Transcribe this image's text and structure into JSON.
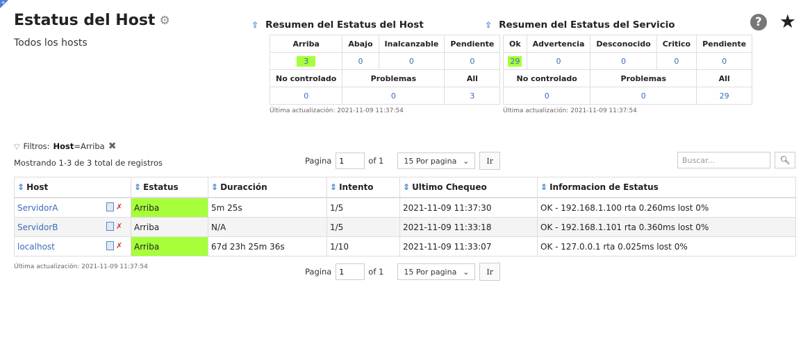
{
  "page": {
    "title": "Estatus del Host",
    "subtitle": "Todos los hosts"
  },
  "host_summary": {
    "title": "Resumen del Estatus del Host",
    "row1_headers": [
      "Arriba",
      "Abajo",
      "Inalcanzable",
      "Pendiente"
    ],
    "row1_values": [
      "3",
      "0",
      "0",
      "0"
    ],
    "row2_headers": [
      "No controlado",
      "Problemas",
      "All"
    ],
    "row2_values": [
      "0",
      "0",
      "3"
    ],
    "updated": "Última actualización: 2021-11-09 11:37:54"
  },
  "service_summary": {
    "title": "Resumen del Estatus del Servicio",
    "row1_headers": [
      "Ok",
      "Advertencia",
      "Desconocido",
      "Critico",
      "Pendiente"
    ],
    "row1_values": [
      "29",
      "0",
      "0",
      "0",
      "0"
    ],
    "row2_headers": [
      "No controlado",
      "Problemas",
      "All"
    ],
    "row2_values": [
      "0",
      "0",
      "29"
    ],
    "updated": "Última actualización: 2021-11-09 11:37:54"
  },
  "filters": {
    "label": "Filtros:",
    "key": "Host",
    "value": "=Arriba",
    "showing": "Mostrando 1-3 de 3 total de registros"
  },
  "pager": {
    "label": "Pagina",
    "page": "1",
    "of": "of 1",
    "per_page": "15 Por pagina",
    "go": "Ir"
  },
  "search": {
    "placeholder": "Buscar..."
  },
  "table": {
    "headers": [
      "Host",
      "Estatus",
      "Duracción",
      "Intento",
      "Ultimo Chequeo",
      "Informacion de Estatus"
    ],
    "rows": [
      {
        "host": "ServidorA",
        "status": "Arriba",
        "duration": "5m 25s",
        "attempt": "1/5",
        "last_check": "2021-11-09 11:37:30",
        "info": "OK - 192.168.1.100 rta 0.260ms lost 0%"
      },
      {
        "host": "ServidorB",
        "status": "Arriba",
        "duration": "N/A",
        "attempt": "1/5",
        "last_check": "2021-11-09 11:33:18",
        "info": "OK - 192.168.1.101 rta 0.360ms lost 0%"
      },
      {
        "host": "localhost",
        "status": "Arriba",
        "duration": "67d 23h 25m 36s",
        "attempt": "1/10",
        "last_check": "2021-11-09 11:33:07",
        "info": "OK - 127.0.0.1 rta 0.025ms lost 0%"
      }
    ],
    "updated": "Última actualización: 2021-11-09 11:37:54"
  },
  "colors": {
    "status_up": "#a6ff3a",
    "link": "#3a6bb8",
    "accent": "#3b82d6"
  },
  "icons": [
    "gear-icon",
    "help-icon",
    "star-icon",
    "pin-icon",
    "funnel-icon",
    "remove-filter-icon",
    "search-icon",
    "sort-icon",
    "status-detail-icon",
    "graph-icon"
  ]
}
